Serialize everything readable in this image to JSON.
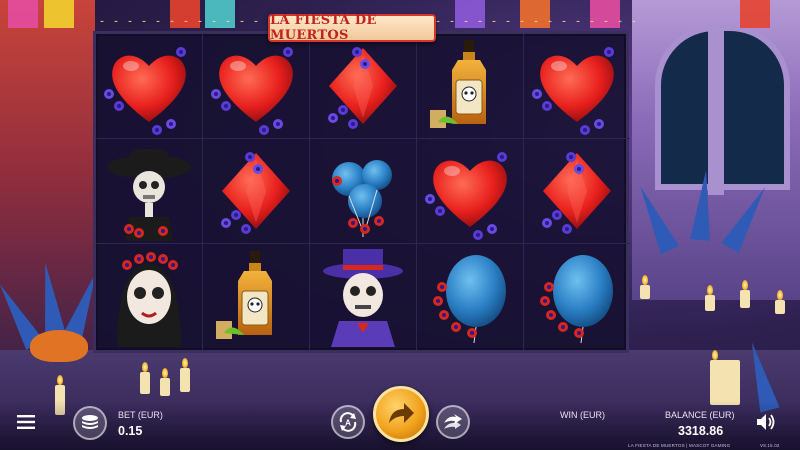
{
  "game": {
    "title": "LA FIESTA DE MUERTOS",
    "provider_line": "LA FIESTA DE MUERTOS | MASCOT GAMING",
    "version": "V8.15.02"
  },
  "reels": [
    [
      "heart",
      "skeleton-woman",
      "catrina-woman"
    ],
    [
      "heart",
      "diamond",
      "tequila"
    ],
    [
      "diamond",
      "balloons",
      "catrin-man"
    ],
    [
      "tequila",
      "heart",
      "balloon"
    ],
    [
      "heart",
      "diamond",
      "balloon"
    ]
  ],
  "hud": {
    "bet_label": "BET (EUR)",
    "bet_value": "0.15",
    "win_label": "WIN (EUR)",
    "win_value": "",
    "balance_label": "BALANCE (EUR)",
    "balance_value": "3318.86"
  },
  "icons": {
    "menu": "menu-icon",
    "coins": "coin-stack-icon",
    "autoplay": "autoplay-icon",
    "spin": "spin-arrow-icon",
    "turbo": "turbo-icon",
    "sound": "speaker-icon"
  },
  "colors": {
    "spin_button": "#f2a21d",
    "reel_bg": "#16102f",
    "title_text": "#c0221c",
    "heart": "#e8201d",
    "balloon": "#2a7fc4"
  }
}
